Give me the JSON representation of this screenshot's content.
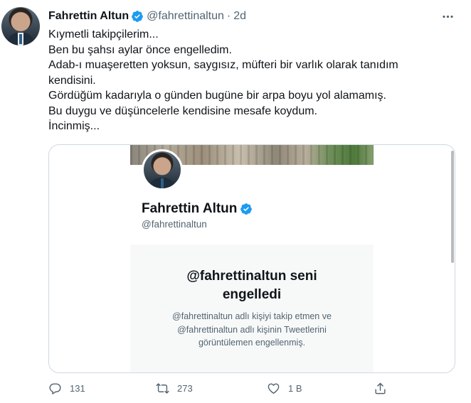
{
  "tweet": {
    "author_name": "Fahrettin Altun",
    "handle": "@fahrettinaltun",
    "separator": "·",
    "time": "2d",
    "lines": [
      "Kıymetli takipçilerim...",
      "Ben bu şahsı aylar önce engelledim.",
      "Adab-ı muaşeretten yoksun, saygısız, müfteri bir varlık olarak tanıdım",
      "kendisini.",
      "Gördüğüm kadarıyla o günden bugüne bir arpa boyu yol alamamış.",
      "Bu duygu ve düşüncelerle kendisine mesafe koydum.",
      "İncinmiş..."
    ]
  },
  "attached_image": {
    "profile_name": "Fahrettin Altun",
    "profile_handle": "@fahrettinaltun",
    "block_title_line1": "@fahrettinaltun seni",
    "block_title_line2": "engelledi",
    "block_desc_line1": "@fahrettinaltun adlı kişiyi takip etmen ve",
    "block_desc_line2": "@fahrettinaltun adlı kişinin Tweetlerini",
    "block_desc_line3": "görüntülemen engellenmiş."
  },
  "actions": {
    "replies": "131",
    "retweets": "273",
    "likes": "1 B"
  },
  "icons": {
    "verified": "verified-badge-icon",
    "more": "more-icon",
    "reply": "reply-icon",
    "retweet": "retweet-icon",
    "like": "heart-icon",
    "share": "share-icon"
  },
  "colors": {
    "verified_blue": "#1d9bf0",
    "text_primary": "#0f1419",
    "text_secondary": "#536471",
    "border": "#cfd9de"
  }
}
